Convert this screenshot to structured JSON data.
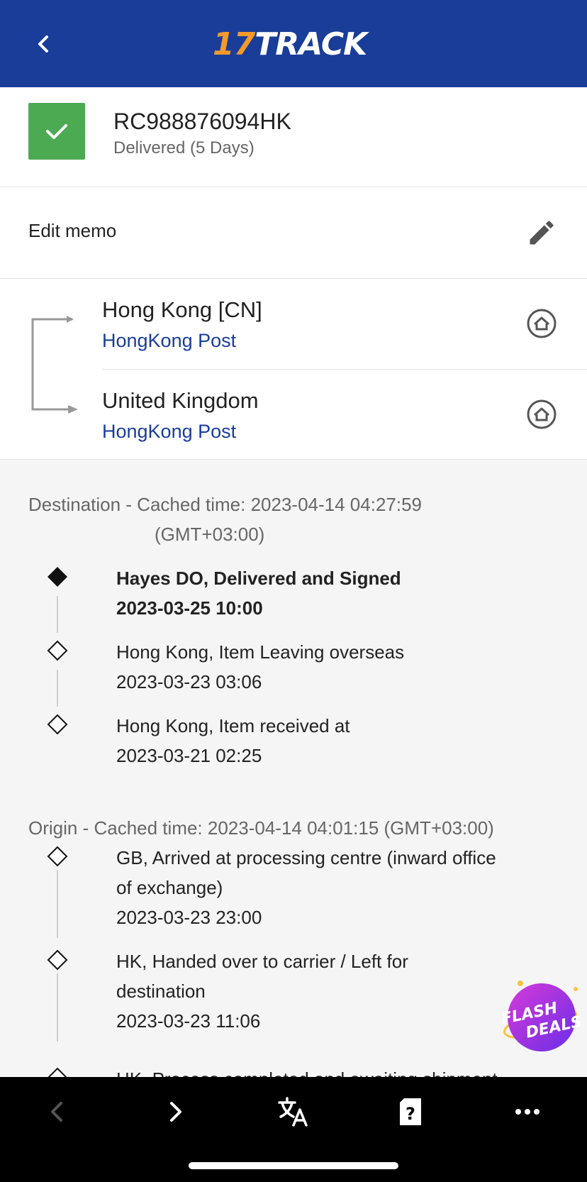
{
  "header": {
    "logo_num": "17",
    "logo_word": "TRACK",
    "back_icon": "chevron-left-icon",
    "background": "#1a3d99"
  },
  "tracking": {
    "number": "RC988876094HK",
    "status": "Delivered (5 Days)",
    "status_color": "#4caa53"
  },
  "memo": {
    "label": "Edit memo"
  },
  "route": {
    "origin": {
      "country": "Hong Kong [CN]",
      "carrier": "HongKong Post"
    },
    "destination": {
      "country": "United Kingdom",
      "carrier": "HongKong Post"
    }
  },
  "destination_section": {
    "title_line1": "Destination - Cached time: 2023-04-14 04:27:59",
    "title_line2": "(GMT+03:00)",
    "events": [
      {
        "line1": "Hayes DO, Delivered and Signed",
        "time": "2023-03-25 10:00"
      },
      {
        "line1": "Hong Kong, Item Leaving overseas",
        "time": "2023-03-23 03:06"
      },
      {
        "line1": "Hong Kong, Item received at",
        "time": "2023-03-21 02:25"
      }
    ]
  },
  "origin_section": {
    "title": "Origin - Cached time: 2023-04-14 04:01:15 (GMT+03:00)",
    "events": [
      {
        "line1": "GB, Arrived at processing centre (inward office",
        "line2": "of exchange)",
        "time": "2023-03-23 23:00"
      },
      {
        "line1": "HK, Handed over to carrier / Left for",
        "line2": "destination",
        "time": "2023-03-23 11:06"
      },
      {
        "line1": "HK, Process completed and awaiting shipment"
      }
    ]
  },
  "promo": {
    "line1": "FLASH",
    "line2": "DEALS"
  },
  "browser_bar": {
    "icons": [
      "back-arrow-icon",
      "forward-arrow-icon",
      "translate-icon",
      "help-card-icon",
      "more-icon"
    ]
  }
}
